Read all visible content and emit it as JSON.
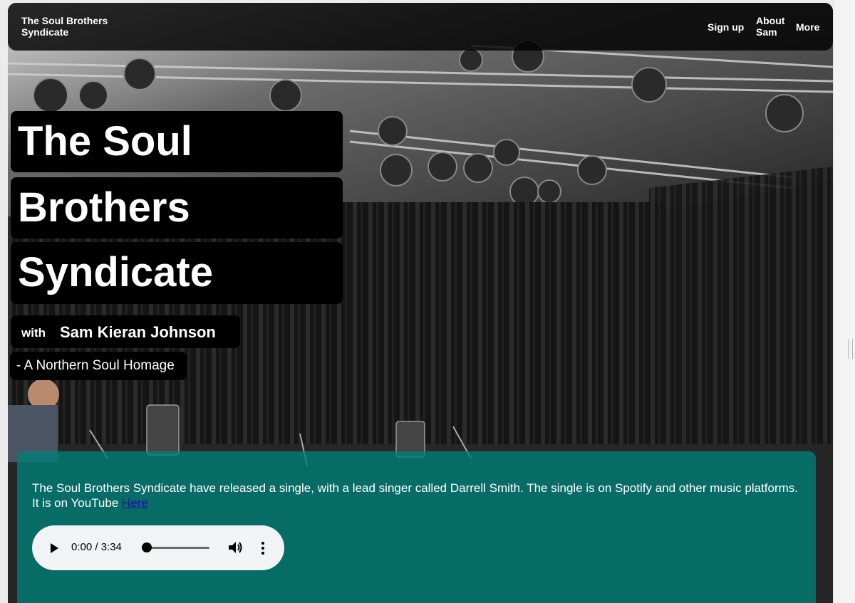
{
  "navbar": {
    "brand": "The Soul Brothers Syndicate",
    "links": [
      {
        "label": "Sign up"
      },
      {
        "label": "About Sam"
      },
      {
        "label": "More"
      }
    ]
  },
  "hero": {
    "title_lines": [
      "The Soul",
      "Brothers",
      "Syndicate"
    ],
    "with_word": "with",
    "with_name": "Sam Kieran Johnson",
    "tagline": "- A Northern Soul Homage"
  },
  "info": {
    "text": "The Soul Brothers Syndicate have released a single, with a lead singer called Darrell Smith. The single is on Spotify and other music platforms. It is on YouTube",
    "link_label": "Here"
  },
  "audio": {
    "time_display": "0:00 / 3:34",
    "progress": 0
  },
  "colors": {
    "panel_teal": "#008078",
    "link_blue": "#1a0dab",
    "title_bg": "#000000"
  }
}
